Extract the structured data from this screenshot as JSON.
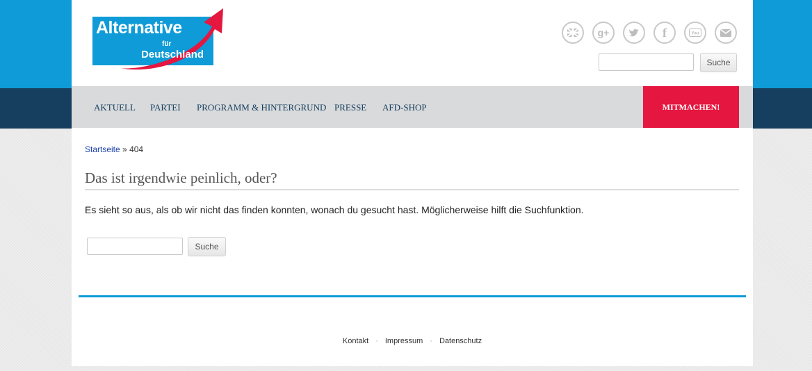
{
  "brand": {
    "line1": "Alternative",
    "line2": "für",
    "line3": "Deutschland",
    "colors": {
      "blue": "#0f9bd7",
      "red": "#e5163f",
      "navy": "#163e5e"
    }
  },
  "header": {
    "social_icons": [
      "uk-flag-icon",
      "google-plus-icon",
      "twitter-icon",
      "facebook-icon",
      "youtube-icon",
      "mail-icon"
    ],
    "search_button": "Suche"
  },
  "nav": {
    "items": [
      "AKTUELL",
      "PARTEI",
      "PROGRAMM & HINTERGRUND",
      "PRESSE",
      "AFD-SHOP"
    ],
    "cta": "MITMACHEN!"
  },
  "breadcrumb": {
    "home": "Startseite",
    "separator": "»",
    "current": "404"
  },
  "content": {
    "title": "Das ist irgendwie peinlich, oder?",
    "text": "Es sieht so aus, als ob wir nicht das finden konnten, wonach du gesucht hast. Möglicherweise hilft die Suchfunktion.",
    "search_button": "Suche"
  },
  "footer": {
    "links": [
      "Kontakt",
      "Impressum",
      "Datenschutz"
    ],
    "separator": "·"
  }
}
